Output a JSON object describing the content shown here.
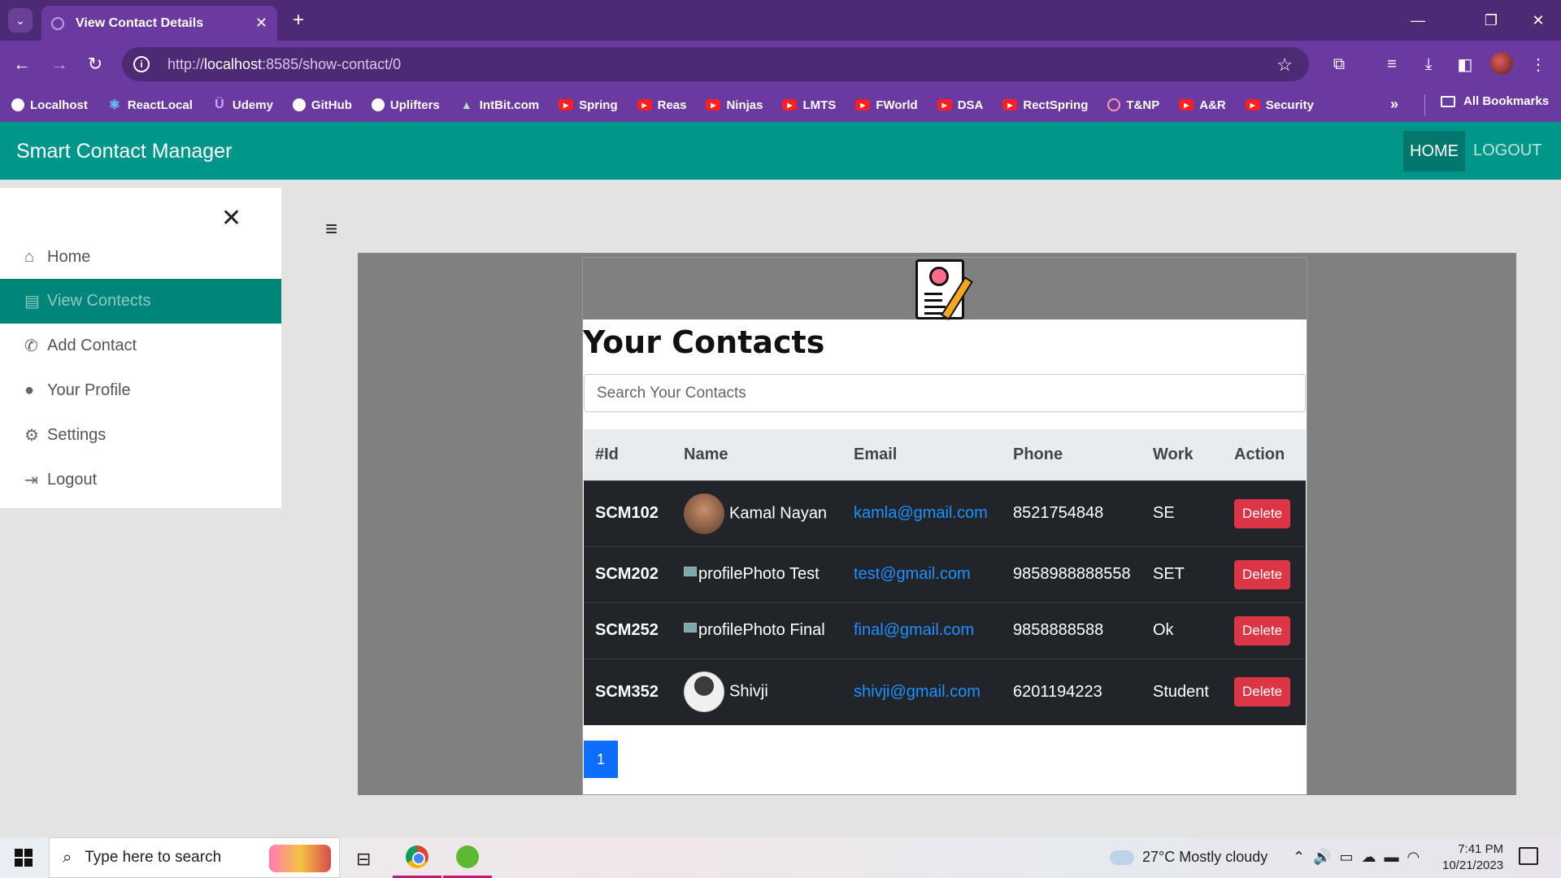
{
  "browser": {
    "tab_title": "View Contact Details",
    "url_prefix": "http://",
    "url_host": "localhost",
    "url_rest": ":8585/show-contact/0",
    "bookmarks": [
      "Localhost",
      "ReactLocal",
      "Udemy",
      "GitHub",
      "Uplifters",
      "IntBit.com",
      "Spring",
      "Reas",
      "Ninjas",
      "LMTS",
      "FWorld",
      "DSA",
      "RectSpring",
      "T&NP",
      "A&R",
      "Security"
    ],
    "more_bookmarks": "»",
    "all_bookmarks": "All Bookmarks"
  },
  "app": {
    "brand": "Smart Contact Manager",
    "nav_home": "HOME",
    "nav_logout": "LOGOUT",
    "accent": "#00978a"
  },
  "sidebar": {
    "items": [
      {
        "label": "Home",
        "icon": "home-icon"
      },
      {
        "label": "View Contects",
        "icon": "file-icon"
      },
      {
        "label": "Add Contact",
        "icon": "phone-icon"
      },
      {
        "label": "Your Profile",
        "icon": "user-icon"
      },
      {
        "label": "Settings",
        "icon": "gear-icon"
      },
      {
        "label": "Logout",
        "icon": "logout-icon"
      }
    ]
  },
  "main": {
    "heading": "Your Contacts",
    "search_placeholder": "Search Your Contacts",
    "columns": [
      "#Id",
      "Name",
      "Email",
      "Phone",
      "Work",
      "Action"
    ],
    "rows": [
      {
        "id": "SCM102",
        "name": "Kamal Nayan",
        "email": "kamla@gmail.com",
        "phone": "8521754848",
        "work": "SE",
        "action": "Delete"
      },
      {
        "id": "SCM202",
        "alt": "profilePhoto",
        "name": "Test",
        "email": "test@gmail.com",
        "phone": "9858988888558",
        "work": "SET",
        "action": "Delete"
      },
      {
        "id": "SCM252",
        "alt": "profilePhoto",
        "name": "Final",
        "email": "final@gmail.com",
        "phone": "9858888588",
        "work": "Ok",
        "action": "Delete"
      },
      {
        "id": "SCM352",
        "name": "Shivji",
        "email": "shivji@gmail.com",
        "phone": "6201194223",
        "work": "Student",
        "action": "Delete"
      }
    ],
    "page": "1"
  },
  "taskbar": {
    "search_placeholder": "Type here to search",
    "weather": "27°C  Mostly cloudy",
    "time": "7:41 PM",
    "date": "10/21/2023"
  }
}
